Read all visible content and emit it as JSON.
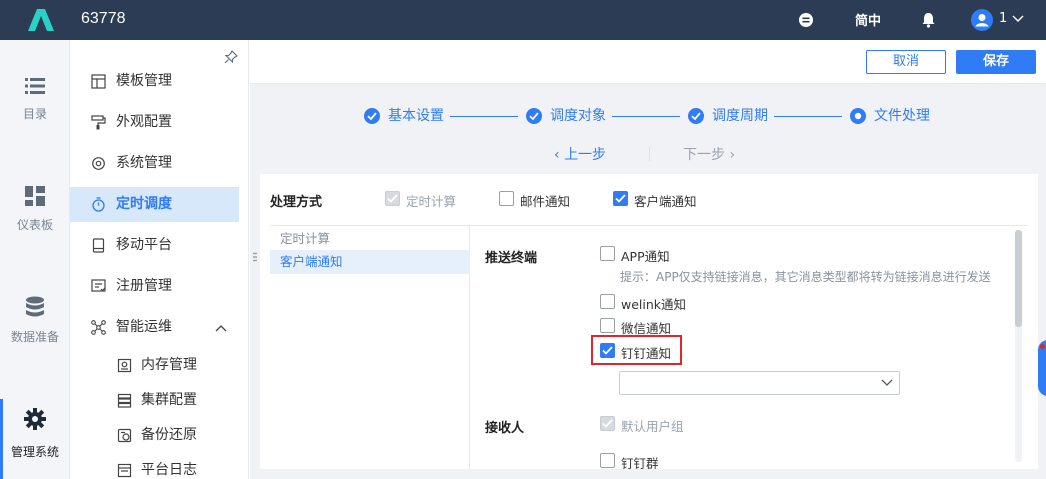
{
  "header": {
    "app_title": "63778",
    "lang_label": "简中",
    "user_name": "1",
    "icons": [
      "logo-icon",
      "stop-circle-icon",
      "bell-icon",
      "user-avatar-icon",
      "chevron-down-icon"
    ]
  },
  "rail": {
    "items": [
      {
        "label": "目录",
        "icon": "list-icon"
      },
      {
        "label": "仪表板",
        "icon": "dashboard-icon"
      },
      {
        "label": "数据准备",
        "icon": "database-icon"
      },
      {
        "label": "管理系统",
        "icon": "gear-icon",
        "active": true
      }
    ]
  },
  "sidemenu": {
    "items": [
      {
        "label": "模板管理",
        "icon": "template-icon"
      },
      {
        "label": "外观配置",
        "icon": "paint-roller-icon"
      },
      {
        "label": "系统管理",
        "icon": "settings-icon"
      },
      {
        "label": "定时调度",
        "icon": "timer-icon",
        "active": true
      },
      {
        "label": "移动平台",
        "icon": "mobile-icon"
      },
      {
        "label": "注册管理",
        "icon": "register-icon"
      },
      {
        "label": "智能运维",
        "icon": "ops-icon",
        "expanded": true
      }
    ],
    "sub_items": [
      {
        "label": "内存管理",
        "icon": "memory-icon"
      },
      {
        "label": "集群配置",
        "icon": "cluster-icon"
      },
      {
        "label": "备份还原",
        "icon": "backup-icon"
      },
      {
        "label": "平台日志",
        "icon": "log-icon"
      }
    ]
  },
  "actions": {
    "cancel_label": "取消",
    "save_label": "保存"
  },
  "steps": [
    {
      "label": "基本设置",
      "state": "done"
    },
    {
      "label": "调度对象",
      "state": "done"
    },
    {
      "label": "调度周期",
      "state": "done"
    },
    {
      "label": "文件处理",
      "state": "current"
    }
  ],
  "nav": {
    "prev_label": "上一步",
    "next_label": "下一步"
  },
  "processing": {
    "label": "处理方式",
    "options": [
      {
        "label": "定时计算",
        "checked": true,
        "disabled": true
      },
      {
        "label": "邮件通知",
        "checked": false,
        "disabled": false
      },
      {
        "label": "客户端通知",
        "checked": true,
        "disabled": false
      }
    ]
  },
  "list": {
    "rows": [
      {
        "label": "定时计算",
        "selected": false
      },
      {
        "label": "客户端通知",
        "selected": true
      }
    ]
  },
  "detail": {
    "push_label": "推送终端",
    "terminals": [
      {
        "label": "APP通知",
        "checked": false
      },
      {
        "label": "welink通知",
        "checked": false
      },
      {
        "label": "微信通知",
        "checked": false
      },
      {
        "label": "钉钉通知",
        "checked": true,
        "highlighted": true
      }
    ],
    "hint": "提示：APP仅支持链接消息，其它消息类型都将转为链接消息进行发送",
    "select_value": "",
    "receiver_label": "接收人",
    "receivers": [
      {
        "label": "默认用户组",
        "checked": true,
        "disabled": true
      },
      {
        "label": "钉钉群",
        "checked": false,
        "disabled": false
      }
    ]
  },
  "colors": {
    "accent": "#2f7cf6",
    "header_bg": "#2b3c54",
    "highlight": "#e0252b"
  }
}
